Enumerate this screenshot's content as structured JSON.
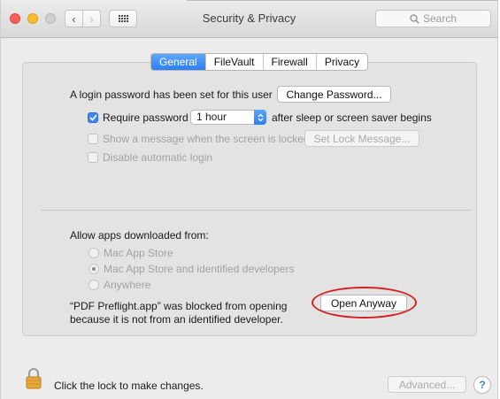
{
  "window": {
    "title": "Security & Privacy"
  },
  "search": {
    "placeholder": "Search"
  },
  "tabs": [
    {
      "label": "General",
      "active": true
    },
    {
      "label": "FileVault",
      "active": false
    },
    {
      "label": "Firewall",
      "active": false
    },
    {
      "label": "Privacy",
      "active": false
    }
  ],
  "general": {
    "login_text": "A login password has been set for this user",
    "change_password_label": "Change Password...",
    "require_password_label": "Require password",
    "require_password_checked": true,
    "require_password_delay": "1 hour",
    "after_sleep_text": "after sleep or screen saver begins",
    "show_message_label": "Show a message when the screen is locked",
    "set_lock_message_label": "Set Lock Message...",
    "disable_auto_login_label": "Disable automatic login"
  },
  "apps": {
    "heading": "Allow apps downloaded from:",
    "options": [
      {
        "label": "Mac App Store",
        "selected": false
      },
      {
        "label": "Mac App Store and identified developers",
        "selected": true
      },
      {
        "label": "Anywhere",
        "selected": false
      }
    ],
    "blocked_line1": "“PDF Preflight.app” was blocked from opening",
    "blocked_line2": "because it is not from an identified developer.",
    "open_anyway_label": "Open Anyway"
  },
  "footer": {
    "lock_text": "Click the lock to make changes.",
    "advanced_label": "Advanced...",
    "help_label": "?"
  },
  "colors": {
    "accent": "#2f7ef3",
    "annotation": "#d42121"
  }
}
